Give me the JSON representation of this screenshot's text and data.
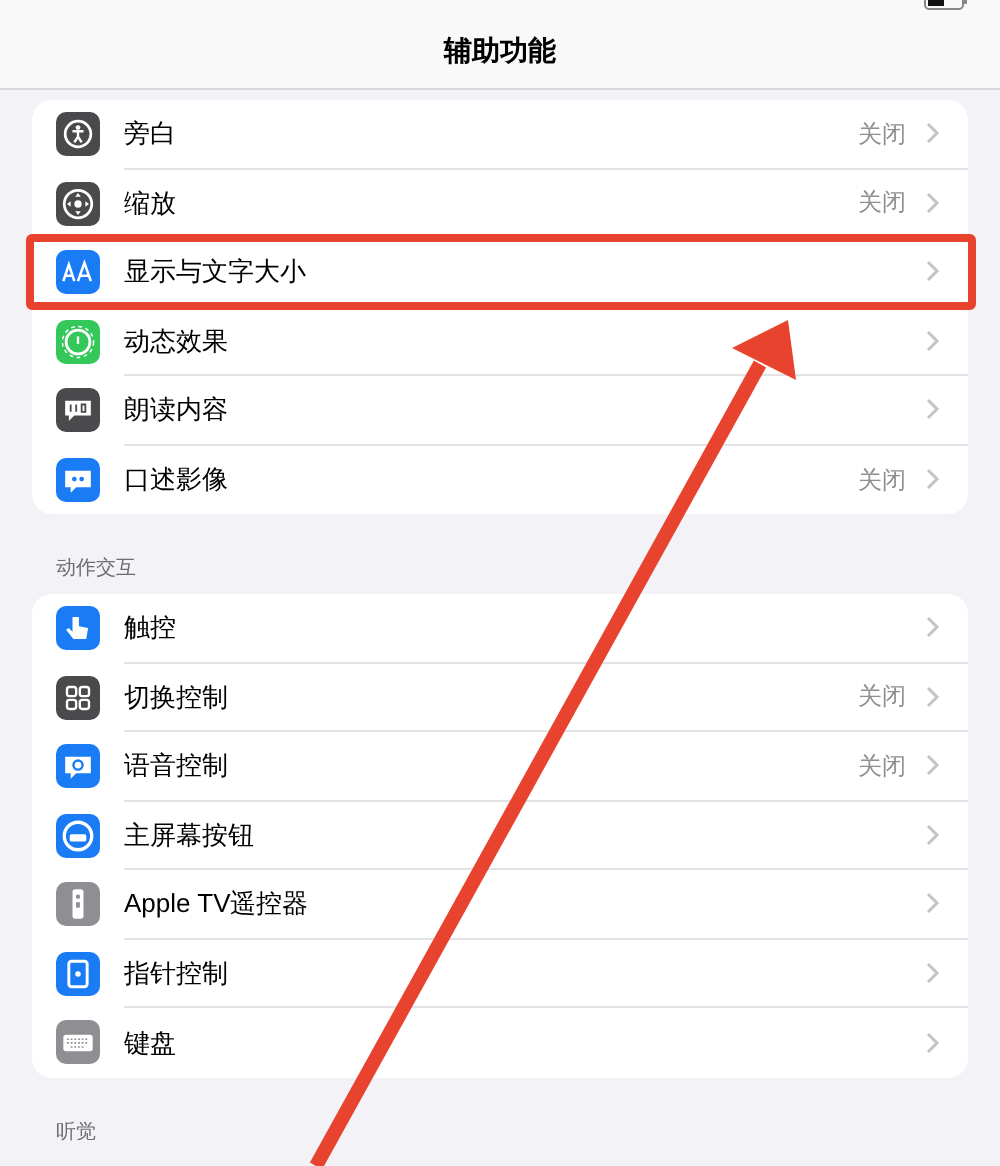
{
  "nav": {
    "title": "辅助功能"
  },
  "groups": [
    {
      "items": [
        {
          "label": "旁白",
          "value": "关闭",
          "kind": "voiceover",
          "color": "#4a4a4c",
          "highlighted": false
        },
        {
          "label": "缩放",
          "value": "关闭",
          "kind": "zoom",
          "color": "#4a4a4c",
          "highlighted": false
        },
        {
          "label": "显示与文字大小",
          "kind": "text-size",
          "color": "#1a7cf5",
          "highlighted": true
        },
        {
          "label": "动态效果",
          "kind": "motion",
          "color": "#34c759",
          "highlighted": false
        },
        {
          "label": "朗读内容",
          "kind": "speech",
          "color": "#4a4a4c",
          "highlighted": false
        },
        {
          "label": "口述影像",
          "value": "关闭",
          "kind": "description",
          "color": "#1a7cf5",
          "highlighted": false
        }
      ]
    },
    {
      "header": "动作交互",
      "items": [
        {
          "label": "触控",
          "kind": "touch",
          "color": "#1a7cf5",
          "highlighted": false
        },
        {
          "label": "切换控制",
          "value": "关闭",
          "kind": "switch",
          "color": "#4a4a4c",
          "highlighted": false
        },
        {
          "label": "语音控制",
          "value": "关闭",
          "kind": "voice",
          "color": "#1a7cf5",
          "highlighted": false
        },
        {
          "label": "主屏幕按钮",
          "kind": "home",
          "color": "#1a7cf5",
          "highlighted": false
        },
        {
          "label": "Apple TV遥控器",
          "kind": "remote",
          "color": "#8e8e93",
          "highlighted": false
        },
        {
          "label": "指针控制",
          "kind": "pointer",
          "color": "#1a7cf5",
          "highlighted": false
        },
        {
          "label": "键盘",
          "kind": "keyboard",
          "color": "#8e8e93",
          "highlighted": false
        }
      ]
    },
    {
      "header": "听觉"
    }
  ]
}
